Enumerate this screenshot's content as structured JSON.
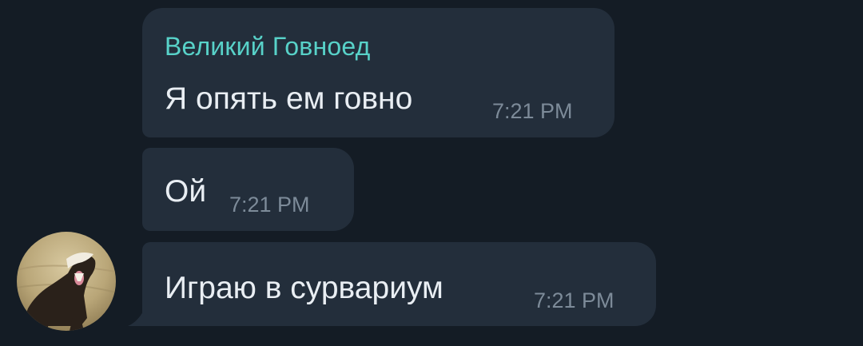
{
  "colors": {
    "background": "#141c25",
    "bubble": "#232e3b",
    "sender_name": "#58d2c9",
    "message_text": "#e9eef3",
    "timestamp": "#7d8b99"
  },
  "sender": {
    "name": "Великий Говноед",
    "avatar_icon": "honey-badger-avatar"
  },
  "messages": [
    {
      "text": "Я опять ем говно",
      "time": "7:21 PM"
    },
    {
      "text": "Ой",
      "time": "7:21 PM"
    },
    {
      "text": "Играю в сурвариум",
      "time": "7:21 PM"
    }
  ]
}
